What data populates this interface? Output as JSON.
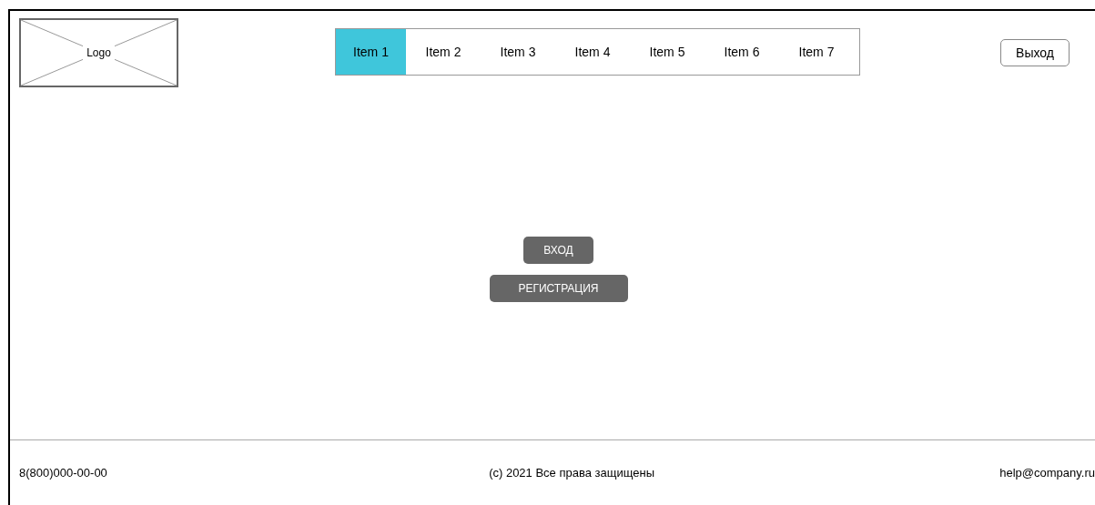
{
  "header": {
    "logo": "Logo",
    "nav": [
      {
        "label": "Item 1",
        "selected": true
      },
      {
        "label": "Item 2",
        "selected": false
      },
      {
        "label": "Item 3",
        "selected": false
      },
      {
        "label": "Item 4",
        "selected": false
      },
      {
        "label": "Item 5",
        "selected": false
      },
      {
        "label": "Item 6",
        "selected": false
      },
      {
        "label": "Item 7",
        "selected": false
      }
    ],
    "logout_button": "Выход"
  },
  "main": {
    "buttons": [
      "ВХОД",
      "РЕГИСТРАЦИЯ"
    ]
  },
  "footer": {
    "phone": "8(800)000-00-00",
    "copyright": "(c) 2021 Все права защищены",
    "email": "help@company.ru"
  }
}
